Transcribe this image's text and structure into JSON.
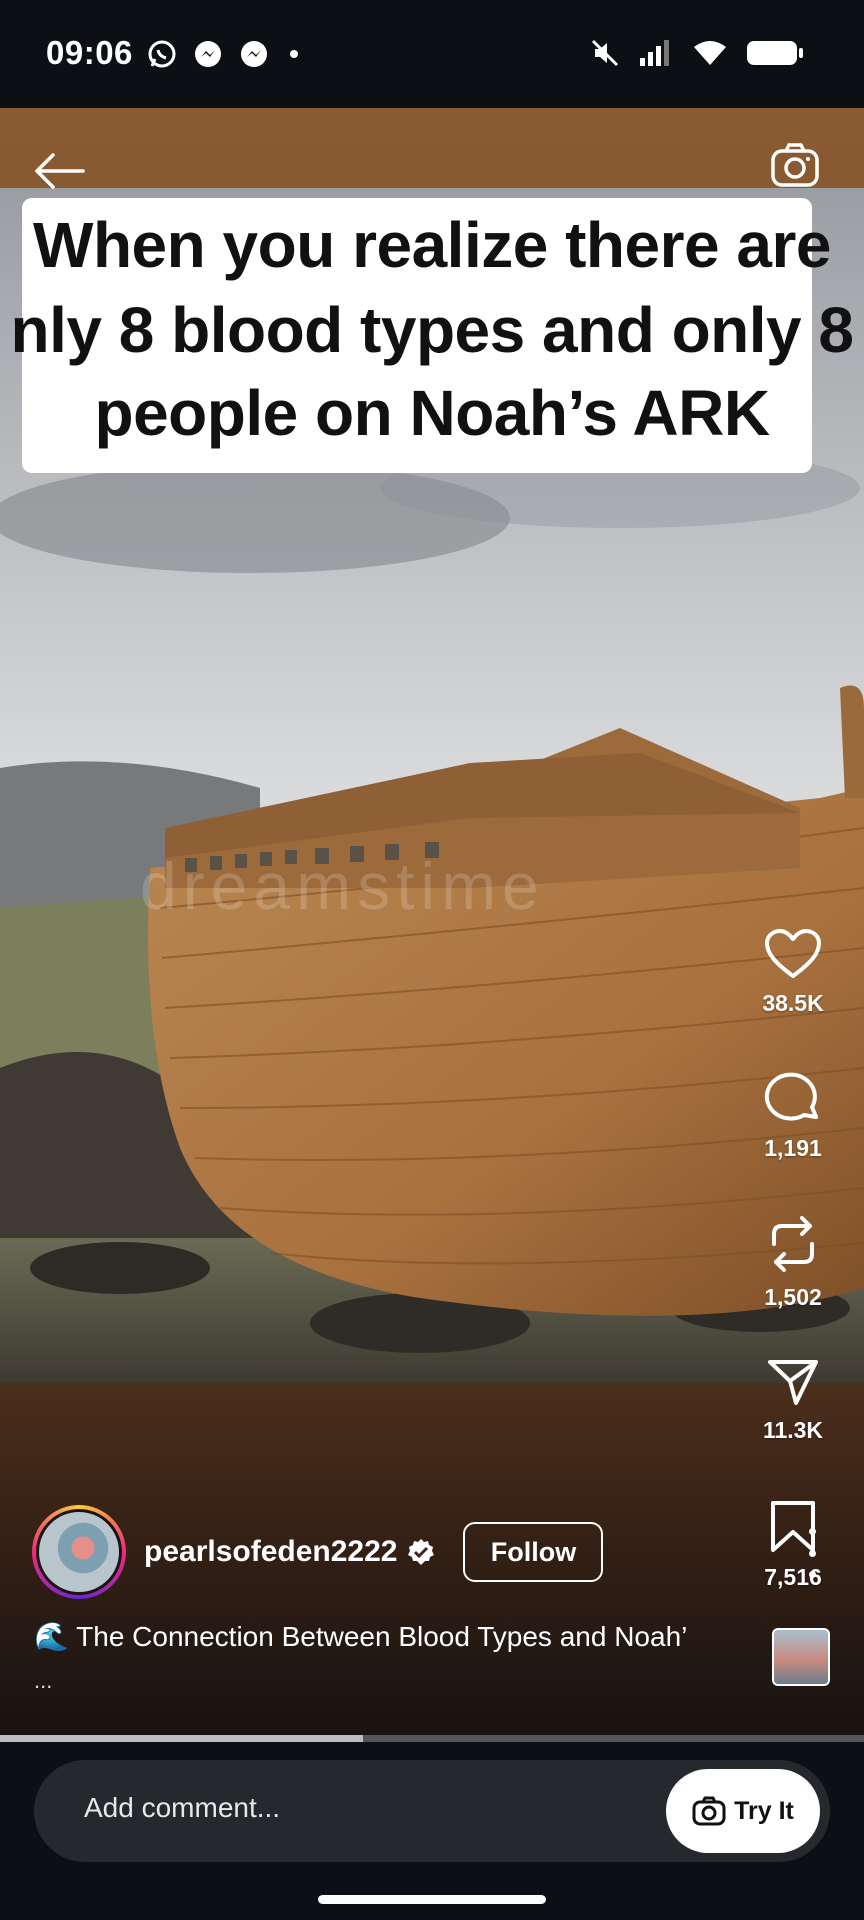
{
  "status_bar": {
    "time": "09:06",
    "left_icons": [
      "whatsapp-icon",
      "messenger-icon",
      "messenger-icon",
      "dot-icon"
    ],
    "right_icons": [
      "mute-icon",
      "signal-icon",
      "wifi-icon",
      "battery-icon"
    ]
  },
  "post": {
    "caption_overlay": [
      "When you realize there are",
      "nly 8 blood types and only 8",
      "people on Noah’s ARK"
    ],
    "watermark": "dreamstime"
  },
  "actions": {
    "like_count": "38.5K",
    "comment_count": "1,191",
    "repost_count": "1,502",
    "share_count": "11.3K",
    "save_count": "7,516"
  },
  "author": {
    "username": "pearlsofeden2222",
    "verified": true,
    "follow_label": "Follow"
  },
  "caption": {
    "text": "🌊 The Connection Between Blood Types and Noah’",
    "more": "..."
  },
  "playback": {
    "progress": 0.42
  },
  "comment_bar": {
    "placeholder": "Add comment...",
    "try_it_label": "Try It"
  },
  "colors": {
    "background": "#0c1014",
    "ark_wood": "#b07a45",
    "comment_bar": "#25292e"
  }
}
